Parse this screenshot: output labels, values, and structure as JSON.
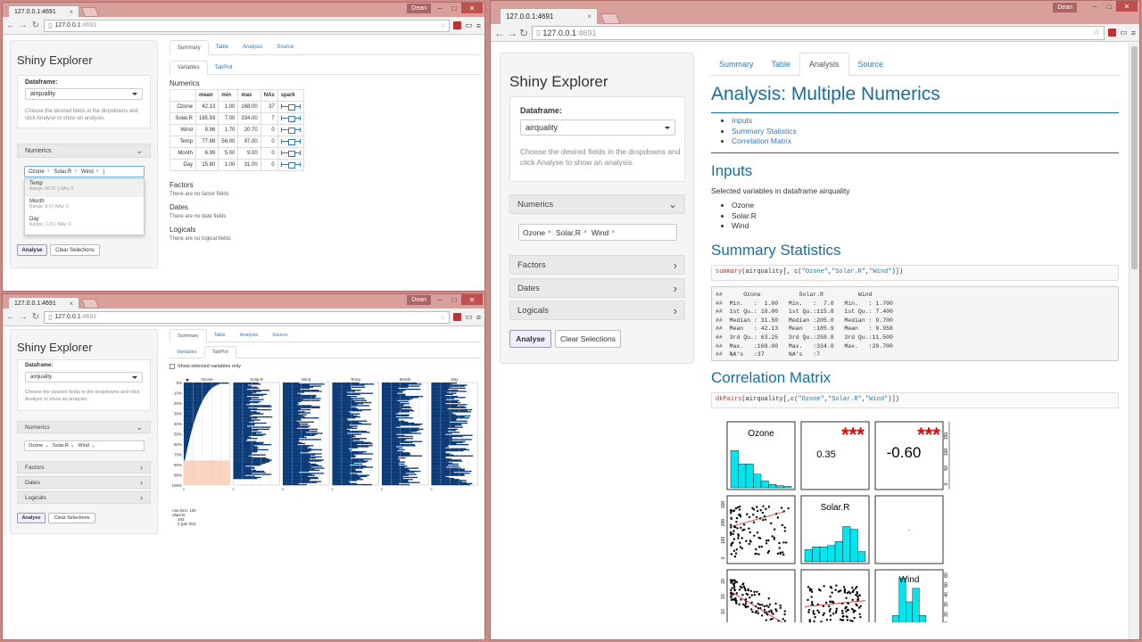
{
  "browser": {
    "tab_title": "127.0.0.1:4691",
    "url_host": "127.0.0.1",
    "url_port": ":4691",
    "user": "Dean"
  },
  "app": {
    "title": "Shiny Explorer",
    "dataframe_label": "Dataframe:",
    "dataframe_value": "airquality",
    "help": "Choose the desired fields in the dropdowns and click Analyse to show an analysis.",
    "sections": {
      "numerics": "Numerics",
      "factors": "Factors",
      "dates": "Dates",
      "logicals": "Logicals"
    },
    "selected": [
      "Ozone",
      "Solar.R",
      "Wind"
    ],
    "analyse_label": "Analyse",
    "clear_label": "Clear Selections",
    "tabs": [
      "Summary",
      "Table",
      "Analysis",
      "Source"
    ],
    "subtabs": [
      "Variables",
      "TabPlot"
    ]
  },
  "dropdown": {
    "options": [
      {
        "name": "Temp",
        "meta": "Range: 56-97 | NAs: 0"
      },
      {
        "name": "Month",
        "meta": "Range: 5-9 | NAs: 0"
      },
      {
        "name": "Day",
        "meta": "Range: 1-31 | NAs: 0"
      }
    ]
  },
  "summary": {
    "numerics_title": "Numerics",
    "headers": [
      "",
      "mean",
      "min",
      "max",
      "NAs",
      "spark"
    ],
    "rows": [
      [
        "Ozone",
        "42.13",
        "1.00",
        "168.00",
        "37"
      ],
      [
        "Solar.R",
        "185.93",
        "7.00",
        "334.00",
        "7"
      ],
      [
        "Wind",
        "9.96",
        "1.70",
        "20.70",
        "0"
      ],
      [
        "Temp",
        "77.88",
        "56.00",
        "97.00",
        "0"
      ],
      [
        "Month",
        "6.99",
        "5.00",
        "9.00",
        "0"
      ],
      [
        "Day",
        "15.80",
        "1.00",
        "31.00",
        "0"
      ]
    ],
    "factors_title": "Factors",
    "factors_text": "There are no factor fields",
    "dates_title": "Dates",
    "dates_text": "There are no date fields",
    "logicals_title": "Logicals",
    "logicals_text": "There are no logical fields"
  },
  "tabplot": {
    "checkbox_label": "Show selected variables only",
    "columns": [
      "Ozone",
      "Solar.R",
      "Wind",
      "Temp",
      "Month",
      "Day"
    ],
    "yticks": [
      "0%",
      "10%",
      "20%",
      "30%",
      "40%",
      "50%",
      "60%",
      "70%",
      "80%",
      "90%",
      "100%"
    ],
    "footer": [
      "row bins: 100",
      "objects:",
      "153",
      "2 (per bin)"
    ],
    "colors": {
      "bar": "#0b3a78",
      "na": "#fad4c0",
      "grid": "#e0e0e0"
    }
  },
  "analysis": {
    "title": "Analysis: Multiple Numerics",
    "toc": [
      "Inputs",
      "Summary Statistics",
      "Correlation Matrix"
    ],
    "inputs_title": "Inputs",
    "inputs_text": "Selected variables in dataframe airquality",
    "inputs_vars": [
      "Ozone",
      "Solar.R",
      "Wind"
    ],
    "stats_title": "Summary Statistics",
    "stats_code": {
      "fn": "summary",
      "rest": "(airquality[, c(",
      "s1": "\"Ozone\"",
      "s2": "\"Solar.R\"",
      "s3": "\"Wind\"",
      "end": ")])"
    },
    "stats_output": "##      Ozone           Solar.R          Wind       \n##  Min.   :  1.00   Min.   :  7.0   Min.   : 1.700  \n##  1st Qu.: 18.00   1st Qu.:115.8   1st Qu.: 7.400  \n##  Median : 31.50   Median :205.0   Median : 9.700  \n##  Mean   : 42.13   Mean   :185.9   Mean   : 9.958  \n##  3rd Qu.: 63.25   3rd Qu.:258.8   3rd Qu.:11.500  \n##  Max.   :168.00   Max.   :334.0   Max.   :20.700  \n##  NA's   :37       NA's   :7                        ",
    "corr_title": "Correlation Matrix",
    "corr_code": {
      "fn": "dkPairs",
      "rest": "(airquality[,c(",
      "s1": "\"Ozone\"",
      "s2": "\"Solar.R\"",
      "s3": "\"Wind\"",
      "end": ")])"
    },
    "pairs": {
      "labels": [
        "Ozone",
        "Solar.R",
        "Wind"
      ],
      "corr_oz_sol": "0.35",
      "corr_oz_wind": "-0.60",
      "corr_sol_wind": "-",
      "stars": "***",
      "hist_color": "#00e5ee",
      "star_color": "#e00000"
    }
  }
}
